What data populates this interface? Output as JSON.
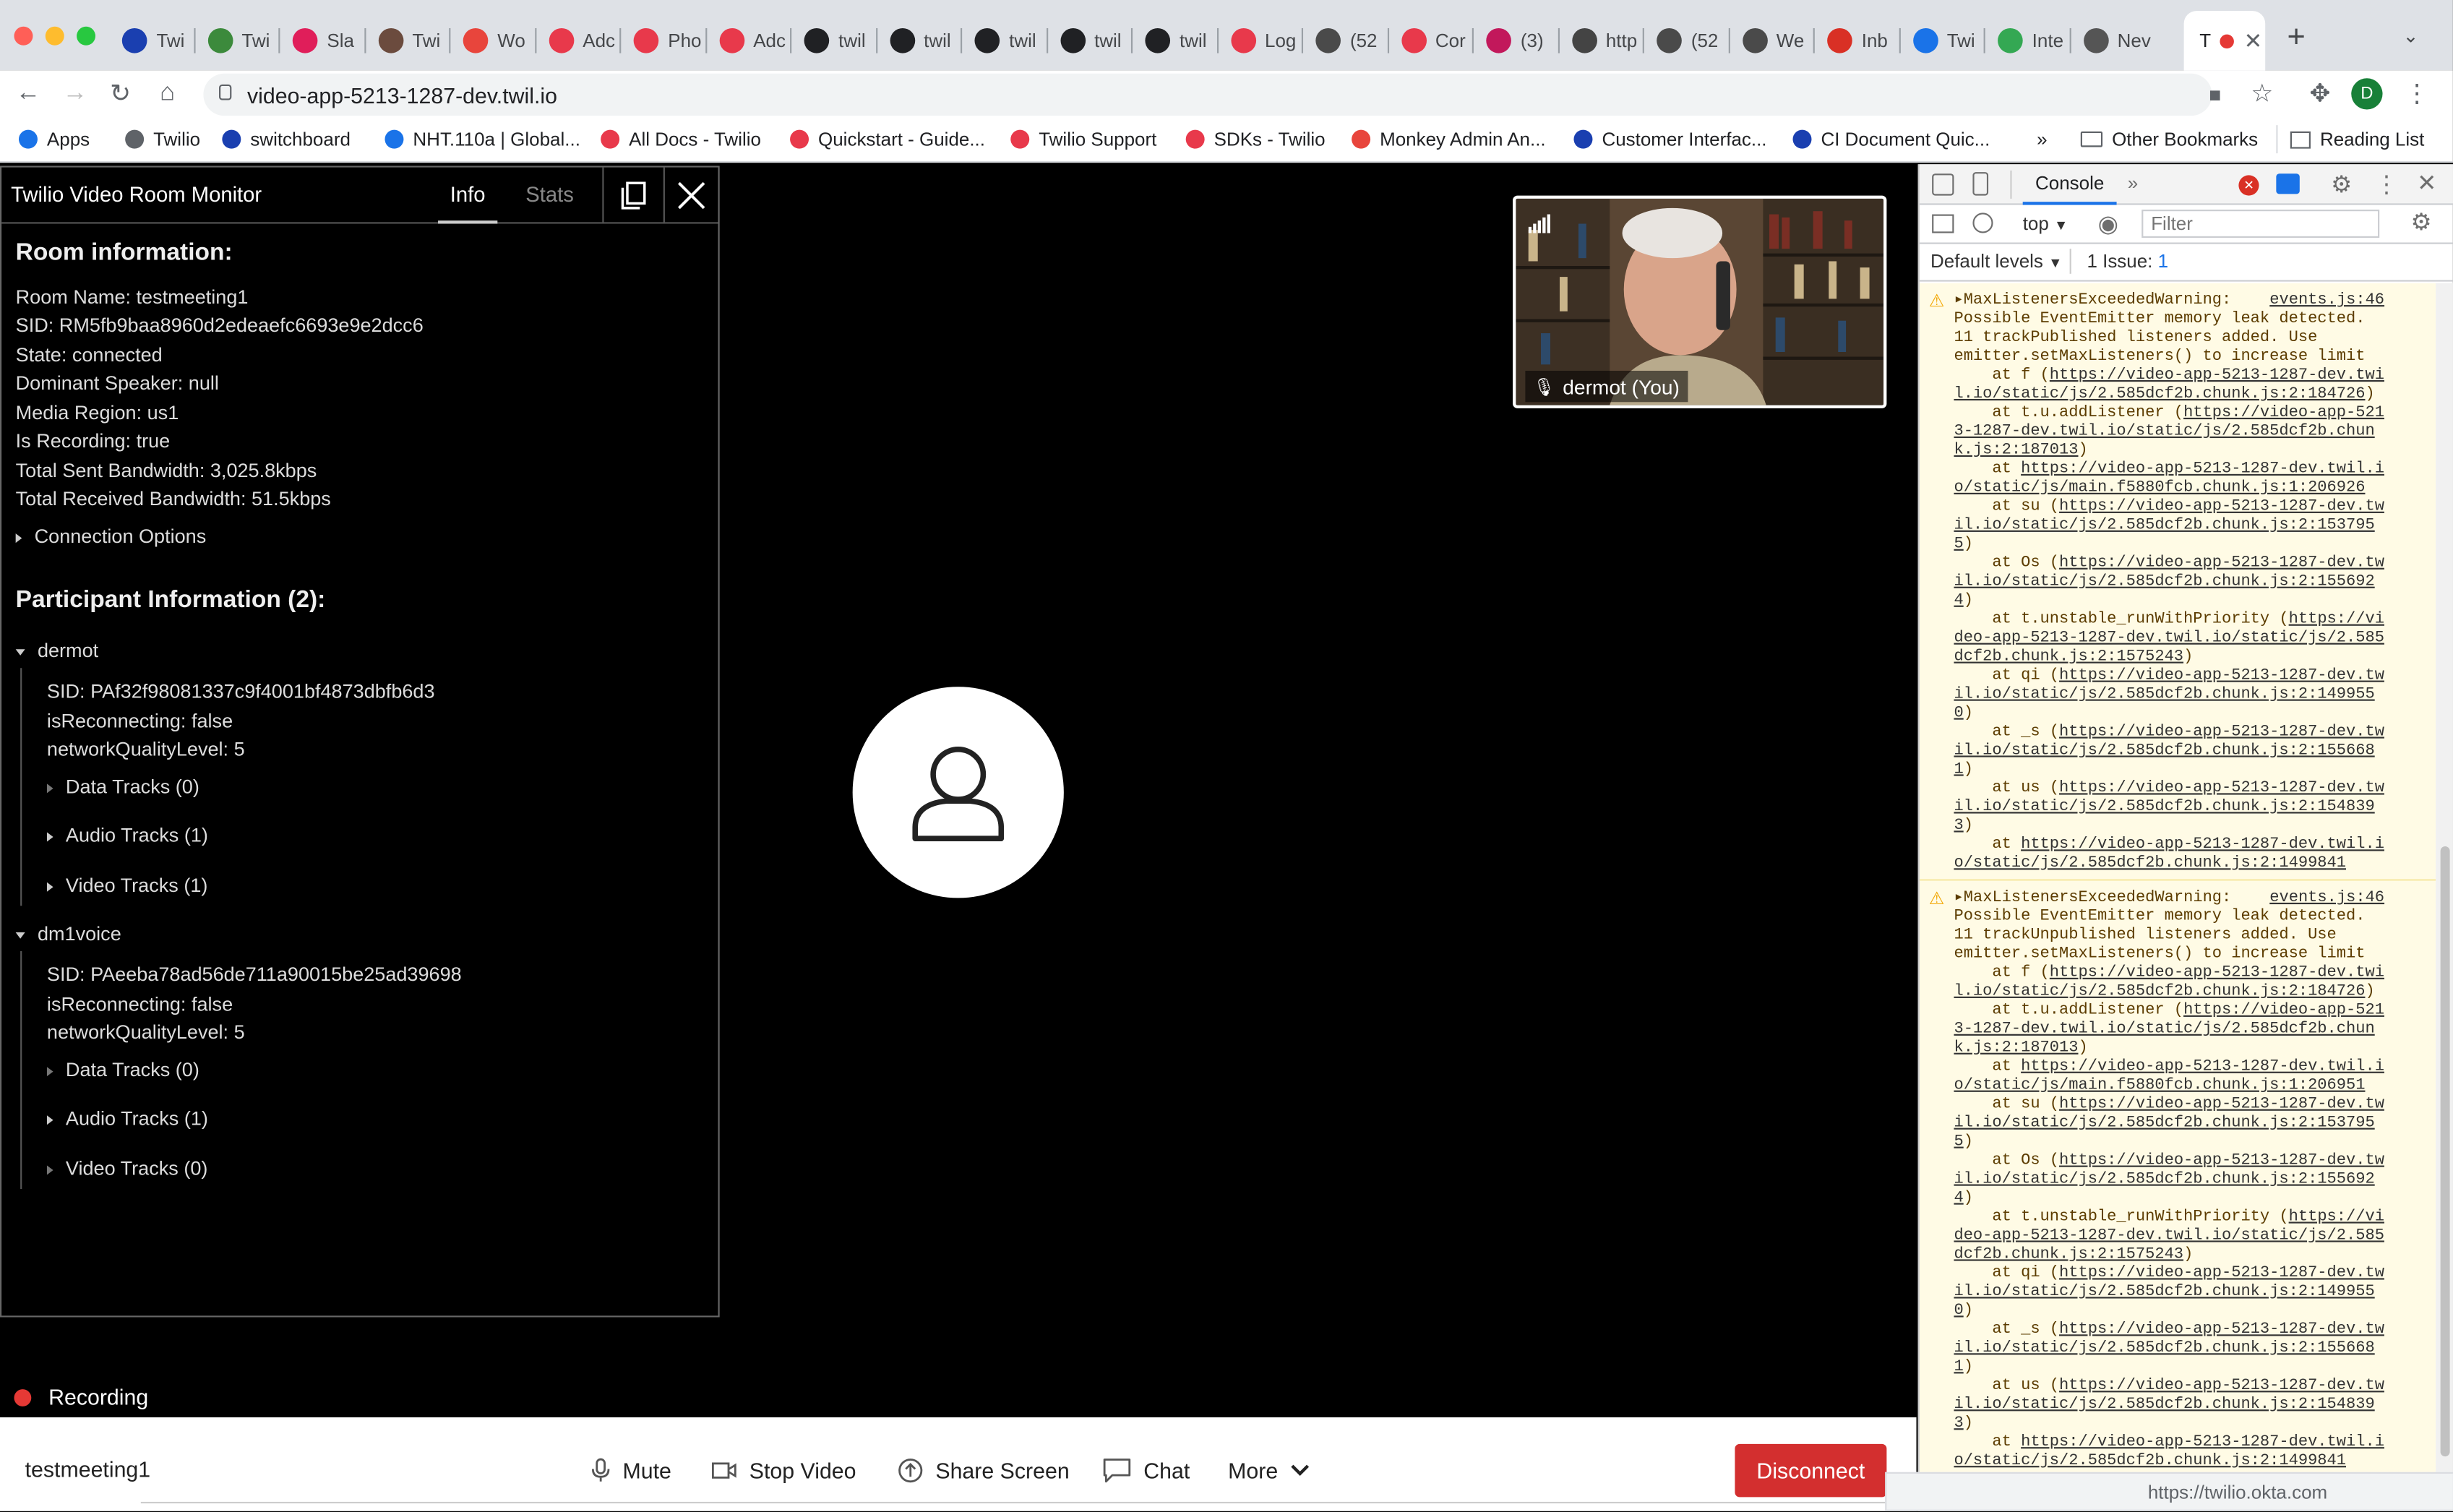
{
  "browser": {
    "tabs": [
      {
        "label": "Twi",
        "icon": "circle-o-icon",
        "color": "#1a3fb0"
      },
      {
        "label": "Twi",
        "icon": "fig-icon",
        "color": "#3c8a3c"
      },
      {
        "label": "Sla",
        "icon": "slack-icon",
        "color": "#e01e5a"
      },
      {
        "label": "Twi",
        "icon": "monkey-icon",
        "color": "#6b4b3e"
      },
      {
        "label": "Wo",
        "icon": "x-icon",
        "color": "#e8453c"
      },
      {
        "label": "Adc",
        "icon": "twilio-icon",
        "color": "#e8394b"
      },
      {
        "label": "Pho",
        "icon": "twilio-icon",
        "color": "#e8394b"
      },
      {
        "label": "Adc",
        "icon": "twilio-icon",
        "color": "#e8394b"
      },
      {
        "label": "twil",
        "icon": "github-icon",
        "color": "#202124"
      },
      {
        "label": "twil",
        "icon": "github-icon",
        "color": "#202124"
      },
      {
        "label": "twil",
        "icon": "github-icon",
        "color": "#202124"
      },
      {
        "label": "twil",
        "icon": "github-icon",
        "color": "#202124"
      },
      {
        "label": "twil",
        "icon": "github-icon",
        "color": "#202124"
      },
      {
        "label": "Log",
        "icon": "twilio-icon",
        "color": "#e8394b"
      },
      {
        "label": "(52",
        "icon": "note-icon",
        "color": "#4a4a4a"
      },
      {
        "label": "Cor",
        "icon": "twilio-icon",
        "color": "#e8394b"
      },
      {
        "label": "(3)",
        "icon": "link-icon",
        "color": "#c2185b"
      },
      {
        "label": "http",
        "icon": "globe-icon",
        "color": "#444"
      },
      {
        "label": "(52",
        "icon": "note-icon",
        "color": "#4a4a4a"
      },
      {
        "label": "We",
        "icon": "note-icon",
        "color": "#4a4a4a"
      },
      {
        "label": "Inb",
        "icon": "gmail-icon",
        "color": "#d93025"
      },
      {
        "label": "Twi",
        "icon": "b-icon",
        "color": "#1a73e8"
      },
      {
        "label": "Inte",
        "icon": "p-icon",
        "color": "#34a853"
      },
      {
        "label": "Nev",
        "icon": "chrome-icon",
        "color": "#555"
      }
    ],
    "active_tab": {
      "label": "T"
    },
    "url": "video-app-5213-1287-dev.twil.io",
    "bookmarks": [
      {
        "label": "Apps",
        "color": "#1a73e8"
      },
      {
        "label": "Twilio",
        "color": "#5f6368"
      },
      {
        "label": "switchboard",
        "color": "#1a3fb0"
      },
      {
        "label": "NHT.110a | Global...",
        "color": "#1a73e8"
      },
      {
        "label": "All Docs - Twilio",
        "color": "#e8394b"
      },
      {
        "label": "Quickstart - Guide...",
        "color": "#e8394b"
      },
      {
        "label": "Twilio Support",
        "color": "#e8394b"
      },
      {
        "label": "SDKs - Twilio",
        "color": "#e8394b"
      },
      {
        "label": "Monkey Admin An...",
        "color": "#e8453c"
      },
      {
        "label": "Customer Interfac...",
        "color": "#1a3fb0"
      },
      {
        "label": "CI Document Quic...",
        "color": "#1a3fb0"
      }
    ],
    "bookmarks_more": "»",
    "other_bookmarks": "Other Bookmarks",
    "reading_list": "Reading List",
    "profile_initial": "D"
  },
  "monitor": {
    "title": "Twilio Video Room Monitor",
    "tab_info": "Info",
    "tab_stats": "Stats",
    "room_heading": "Room information:",
    "room": {
      "name": "Room Name: testmeeting1",
      "sid": "SID: RM5fb9baa8960d2edeaefc6693e9e2dcc6",
      "state": "State: connected",
      "dominant": "Dominant Speaker: null",
      "region": "Media Region: us1",
      "recording": "Is Recording: true",
      "sent": "Total Sent Bandwidth: 3,025.8kbps",
      "received": "Total Received Bandwidth: 51.5kbps",
      "conn_options": "Connection Options"
    },
    "participants_heading": "Participant Information (2):",
    "participants": [
      {
        "name": "dermot",
        "sid": "SID: PAf32f98081337c9f4001bf4873dbfb6d3",
        "reconnecting": "isReconnecting: false",
        "nql": "networkQualityLevel: 5",
        "data": "Data Tracks (0)",
        "audio": "Audio Tracks (1)",
        "video": "Video Tracks (1)"
      },
      {
        "name": "dm1voice",
        "sid": "SID: PAeeba78ad56de711a90015be25ad39698",
        "reconnecting": "isReconnecting: false",
        "nql": "networkQualityLevel: 5",
        "data": "Data Tracks (0)",
        "audio": "Audio Tracks (1)",
        "video": "Video Tracks (0)"
      }
    ]
  },
  "video": {
    "self_label": "dermot (You)",
    "recording_label": "Recording"
  },
  "controls": {
    "room_name": "testmeeting1",
    "mute": "Mute",
    "stop_video": "Stop Video",
    "share_screen": "Share Screen",
    "chat": "Chat",
    "more": "More",
    "disconnect": "Disconnect"
  },
  "devtools": {
    "tab_console": "Console",
    "context": "top",
    "filter_placeholder": "Filter",
    "levels": "Default levels",
    "issues": "1 Issue:",
    "issues_count": "1",
    "status_url": "https://twilio.okta.com",
    "warnings": [
      {
        "head": "MaxListenersExceededWarning:",
        "source": "events.js:46",
        "lines": [
          {
            "t": "Possible EventEmitter memory leak detected."
          },
          {
            "t": "11 trackPublished listeners added. Use"
          },
          {
            "t": "emitter.setMaxListeners() to increase limit"
          },
          {
            "t": "    at f (",
            "l": "https://video-app-5213-1287-dev.twi"
          },
          {
            "t": "",
            "l": "l.io/static/js/2.585dcf2b.chunk.js:2:184726",
            "e": ")"
          },
          {
            "t": "    at t.u.addListener (",
            "l": "https://video-app-521"
          },
          {
            "t": "",
            "l": "3-1287-dev.twil.io/static/js/2.585dcf2b.chun"
          },
          {
            "t": "",
            "l": "k.js:2:187013",
            "e": ")"
          },
          {
            "t": "    at ",
            "l": "https://video-app-5213-1287-dev.twil.i"
          },
          {
            "t": "",
            "l": "o/static/js/main.f5880fcb.chunk.js:1:206926"
          },
          {
            "t": "    at su (",
            "l": "https://video-app-5213-1287-dev.tw"
          },
          {
            "t": "",
            "l": "il.io/static/js/2.585dcf2b.chunk.js:2:153795"
          },
          {
            "t": "",
            "l": "5",
            "e": ")"
          },
          {
            "t": "    at Os (",
            "l": "https://video-app-5213-1287-dev.tw"
          },
          {
            "t": "",
            "l": "il.io/static/js/2.585dcf2b.chunk.js:2:155692"
          },
          {
            "t": "",
            "l": "4",
            "e": ")"
          },
          {
            "t": "    at t.unstable_runWithPriority (",
            "l": "https://vi"
          },
          {
            "t": "",
            "l": "deo-app-5213-1287-dev.twil.io/static/js/2.585"
          },
          {
            "t": "",
            "l": "dcf2b.chunk.js:2:1575243",
            "e": ")"
          },
          {
            "t": "    at qi (",
            "l": "https://video-app-5213-1287-dev.tw"
          },
          {
            "t": "",
            "l": "il.io/static/js/2.585dcf2b.chunk.js:2:149955"
          },
          {
            "t": "",
            "l": "0",
            "e": ")"
          },
          {
            "t": "    at _s (",
            "l": "https://video-app-5213-1287-dev.tw"
          },
          {
            "t": "",
            "l": "il.io/static/js/2.585dcf2b.chunk.js:2:155668"
          },
          {
            "t": "",
            "l": "1",
            "e": ")"
          },
          {
            "t": "    at us (",
            "l": "https://video-app-5213-1287-dev.tw"
          },
          {
            "t": "",
            "l": "il.io/static/js/2.585dcf2b.chunk.js:2:154839"
          },
          {
            "t": "",
            "l": "3",
            "e": ")"
          },
          {
            "t": "    at ",
            "l": "https://video-app-5213-1287-dev.twil.i"
          },
          {
            "t": "",
            "l": "o/static/js/2.585dcf2b.chunk.js:2:1499841"
          }
        ]
      },
      {
        "head": "MaxListenersExceededWarning:",
        "source": "events.js:46",
        "lines": [
          {
            "t": "Possible EventEmitter memory leak detected."
          },
          {
            "t": "11 trackUnpublished listeners added. Use"
          },
          {
            "t": "emitter.setMaxListeners() to increase limit"
          },
          {
            "t": "    at f (",
            "l": "https://video-app-5213-1287-dev.twi"
          },
          {
            "t": "",
            "l": "l.io/static/js/2.585dcf2b.chunk.js:2:184726",
            "e": ")"
          },
          {
            "t": "    at t.u.addListener (",
            "l": "https://video-app-521"
          },
          {
            "t": "",
            "l": "3-1287-dev.twil.io/static/js/2.585dcf2b.chun"
          },
          {
            "t": "",
            "l": "k.js:2:187013",
            "e": ")"
          },
          {
            "t": "    at ",
            "l": "https://video-app-5213-1287-dev.twil.i"
          },
          {
            "t": "",
            "l": "o/static/js/main.f5880fcb.chunk.js:1:206951"
          },
          {
            "t": "    at su (",
            "l": "https://video-app-5213-1287-dev.tw"
          },
          {
            "t": "",
            "l": "il.io/static/js/2.585dcf2b.chunk.js:2:153795"
          },
          {
            "t": "",
            "l": "5",
            "e": ")"
          },
          {
            "t": "    at Os (",
            "l": "https://video-app-5213-1287-dev.tw"
          },
          {
            "t": "",
            "l": "il.io/static/js/2.585dcf2b.chunk.js:2:155692"
          },
          {
            "t": "",
            "l": "4",
            "e": ")"
          },
          {
            "t": "    at t.unstable_runWithPriority (",
            "l": "https://vi"
          },
          {
            "t": "",
            "l": "deo-app-5213-1287-dev.twil.io/static/js/2.585"
          },
          {
            "t": "",
            "l": "dcf2b.chunk.js:2:1575243",
            "e": ")"
          },
          {
            "t": "    at qi (",
            "l": "https://video-app-5213-1287-dev.tw"
          },
          {
            "t": "",
            "l": "il.io/static/js/2.585dcf2b.chunk.js:2:149955"
          },
          {
            "t": "",
            "l": "0",
            "e": ")"
          },
          {
            "t": "    at _s (",
            "l": "https://video-app-5213-1287-dev.tw"
          },
          {
            "t": "",
            "l": "il.io/static/js/2.585dcf2b.chunk.js:2:155668"
          },
          {
            "t": "",
            "l": "1",
            "e": ")"
          },
          {
            "t": "    at us (",
            "l": "https://video-app-5213-1287-dev.tw"
          },
          {
            "t": "",
            "l": "il.io/static/js/2.585dcf2b.chunk.js:2:154839"
          },
          {
            "t": "",
            "l": "3",
            "e": ")"
          },
          {
            "t": "    at ",
            "l": "https://video-app-5213-1287-dev.twil.i"
          },
          {
            "t": "",
            "l": "o/static/js/2.585dcf2b.chunk.js:2:1499841"
          }
        ]
      }
    ]
  },
  "colors": {
    "disconnect": "#d32f2f",
    "recording_dot": "#e53935",
    "warning_bg": "#fffbe5",
    "warning_icon": "#f2a600"
  }
}
